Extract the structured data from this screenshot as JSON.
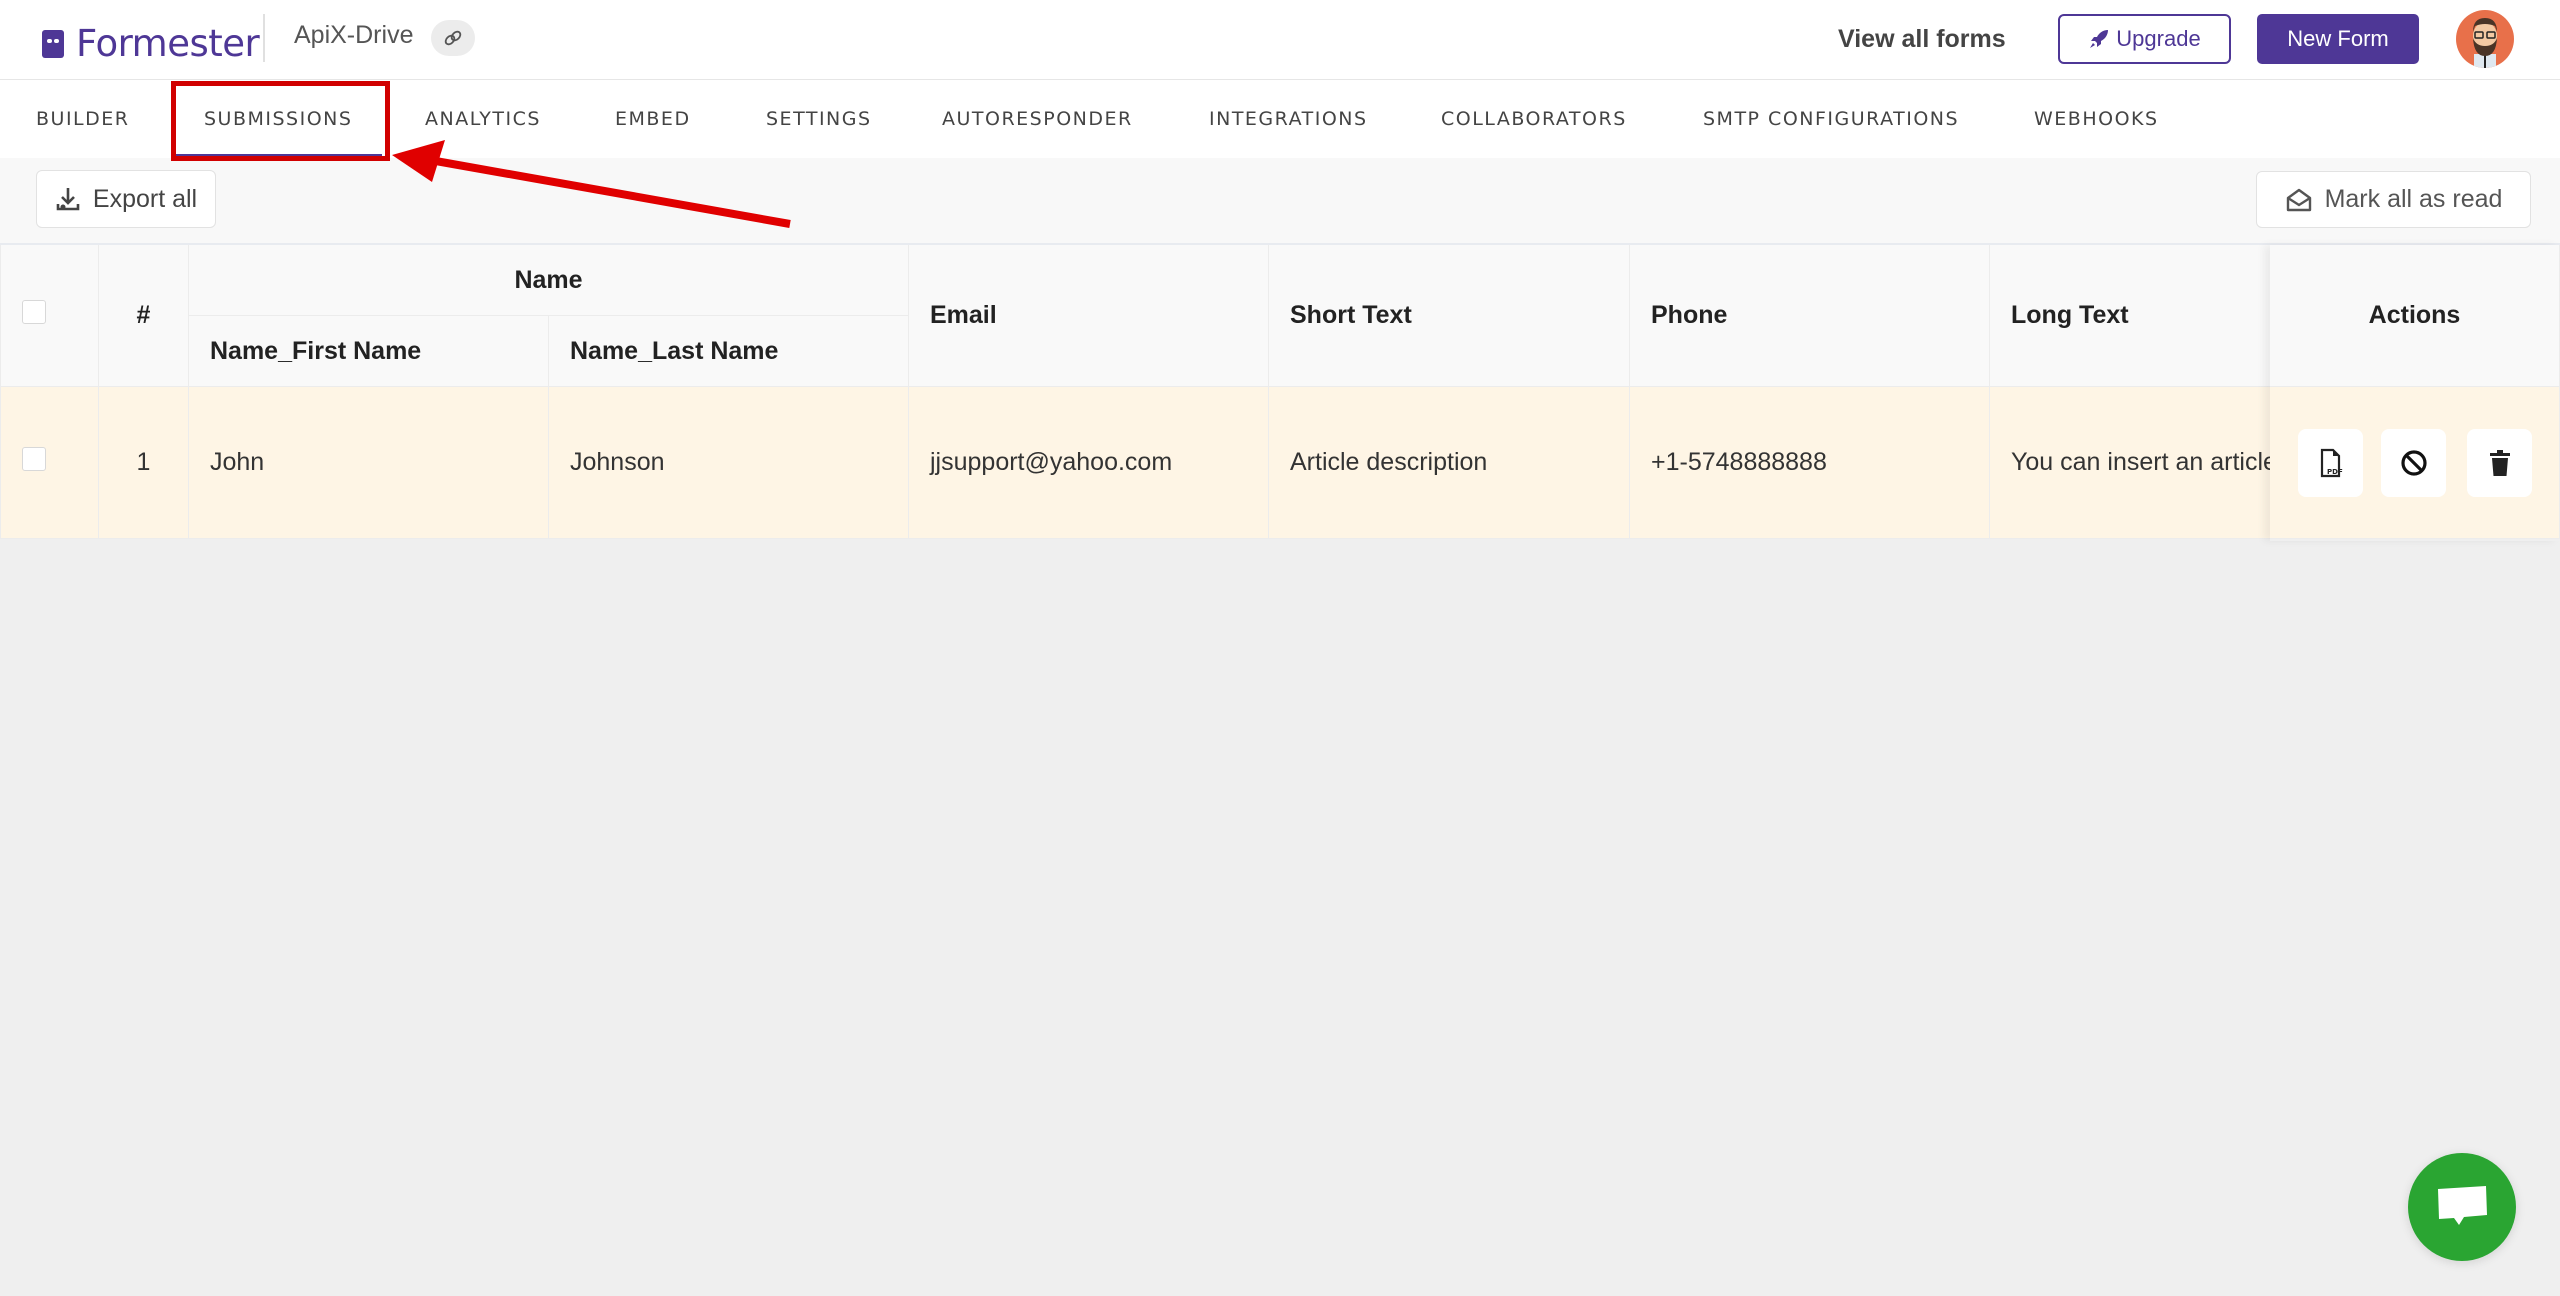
{
  "header": {
    "logo_text": "Formester",
    "form_name": "ApiX-Drive",
    "link_icon": "link-icon",
    "view_all_forms": "View all forms",
    "upgrade_label": "Upgrade",
    "new_form_label": "New Form",
    "avatar_icon": "user-avatar"
  },
  "tabs": [
    {
      "label": "BUILDER",
      "active": false
    },
    {
      "label": "SUBMISSIONS",
      "active": true
    },
    {
      "label": "ANALYTICS",
      "active": false
    },
    {
      "label": "EMBED",
      "active": false
    },
    {
      "label": "SETTINGS",
      "active": false
    },
    {
      "label": "AUTORESPONDER",
      "active": false
    },
    {
      "label": "INTEGRATIONS",
      "active": false
    },
    {
      "label": "COLLABORATORS",
      "active": false
    },
    {
      "label": "SMTP CONFIGURATIONS",
      "active": false
    },
    {
      "label": "WEBHOOKS",
      "active": false
    }
  ],
  "toolbar": {
    "export_label": "Export all",
    "mark_read_label": "Mark all as read"
  },
  "table": {
    "headers": {
      "index": "#",
      "name_group": "Name",
      "first_name": "Name_First Name",
      "last_name": "Name_Last Name",
      "email": "Email",
      "short_text": "Short Text",
      "phone": "Phone",
      "long_text": "Long Text",
      "actions": "Actions"
    },
    "rows": [
      {
        "index": "1",
        "first_name": "John",
        "last_name": "Johnson",
        "email": "jjsupport@yahoo.com",
        "short_text": "Article description",
        "phone": "+1-5748888888",
        "long_text": "You can insert an article"
      }
    ],
    "row_actions": [
      "pdf-download",
      "block",
      "delete"
    ]
  },
  "colors": {
    "brand": "#4e3796",
    "annotation": "#d10000",
    "row_highlight": "#fef5e5",
    "chat": "#2aa532"
  }
}
